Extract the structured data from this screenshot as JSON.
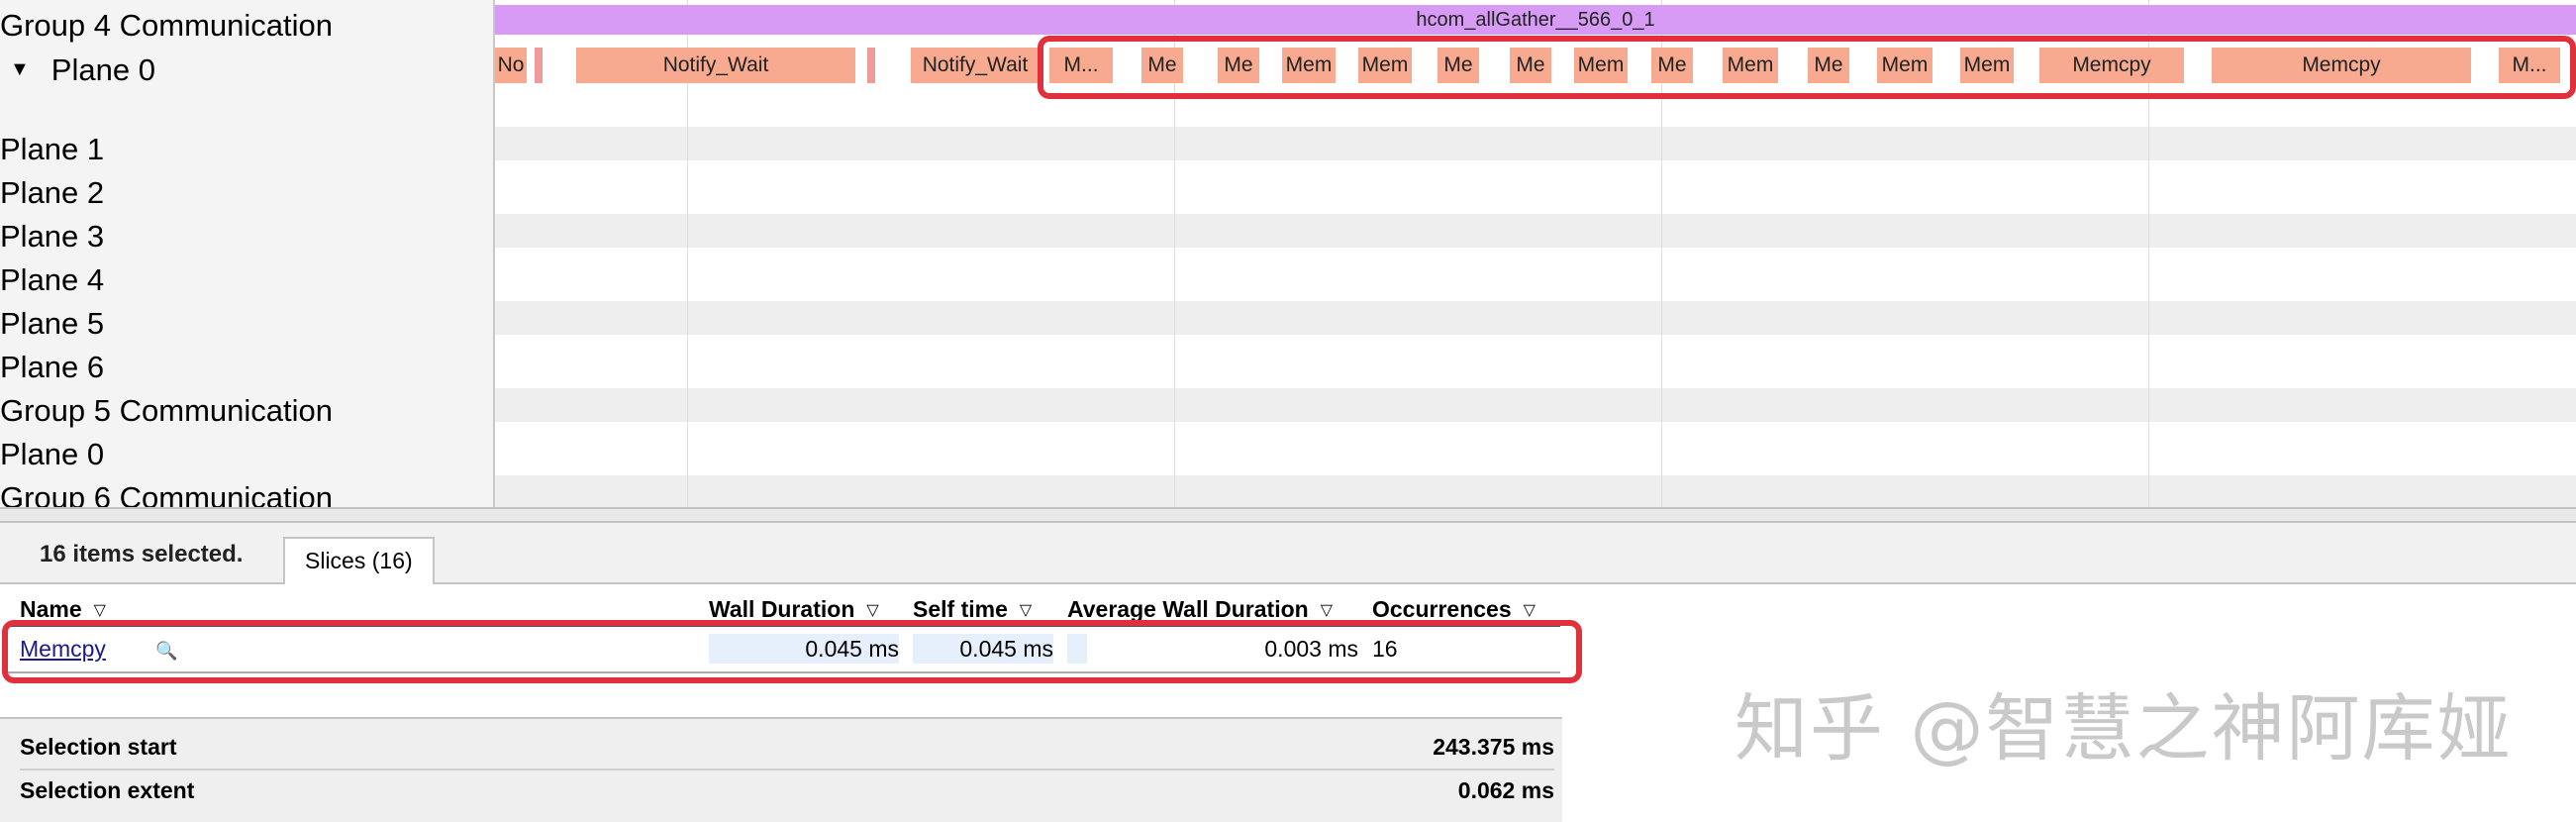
{
  "tracks": [
    {
      "label": "Group 4 Communication",
      "expanded": false
    },
    {
      "label": "Plane 0",
      "expanded": true
    },
    {
      "label": "Plane 1"
    },
    {
      "label": "Plane 2"
    },
    {
      "label": "Plane 3"
    },
    {
      "label": "Plane 4"
    },
    {
      "label": "Plane 5"
    },
    {
      "label": "Plane 6"
    },
    {
      "label": "Group 5 Communication"
    },
    {
      "label": "Plane 0"
    },
    {
      "label": "Group 6 Communication"
    }
  ],
  "timeline": {
    "parent_slice": "hcom_allGather__566_0_1",
    "slices": [
      "No",
      "",
      "Notify_Wait",
      "",
      "Notify_Wait",
      "M...",
      "Me",
      "Me",
      "Mem",
      "Mem",
      "Me",
      "Me",
      "Mem",
      "Me",
      "Mem",
      "Me",
      "Mem",
      "Mem",
      "Memcpy",
      "Memcpy",
      "M..."
    ]
  },
  "bottom_panel": {
    "selection_count": "16 items selected.",
    "tab_label": "Slices (16)",
    "columns": {
      "name": "Name",
      "wall_duration": "Wall Duration",
      "self_time": "Self time",
      "avg_wall_duration": "Average Wall Duration",
      "occurrences": "Occurrences"
    },
    "row": {
      "name": "Memcpy",
      "wall_duration": "0.045 ms",
      "self_time": "0.045 ms",
      "avg_wall_duration": "0.003 ms",
      "occurrences": "16"
    },
    "selection_start_label": "Selection start",
    "selection_start_value": "243.375 ms",
    "selection_extent_label": "Selection extent",
    "selection_extent_value": "0.062 ms"
  },
  "watermark": "知乎 @智慧之神阿库娅",
  "icons": {
    "expander": "triangle-down-icon",
    "sort": "sort-triangle-icon",
    "search": "magnifier-icon"
  },
  "colors": {
    "parent_slice": "#d79bf5",
    "slice": "#f7aa8f",
    "highlight": "#e0303c"
  }
}
